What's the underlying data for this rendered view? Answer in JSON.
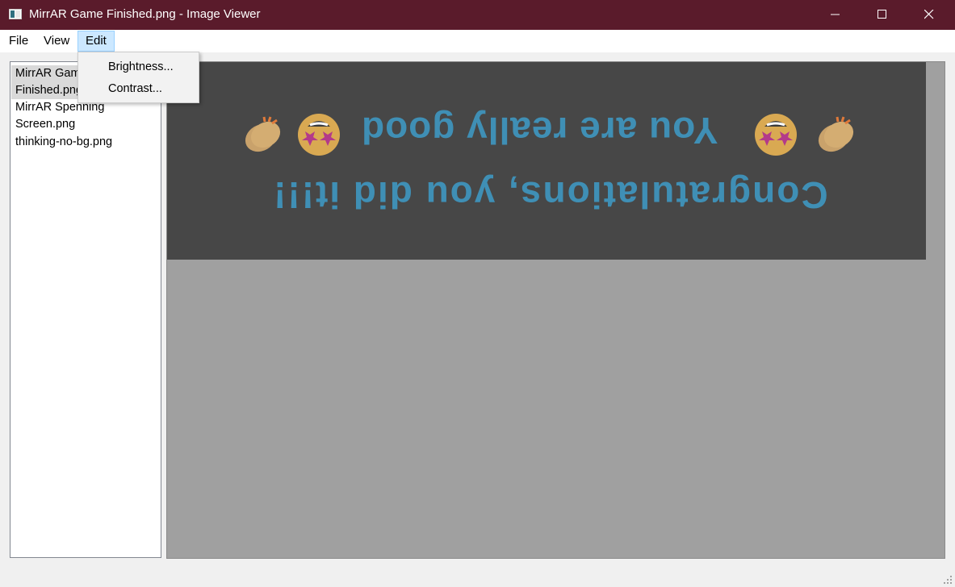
{
  "window": {
    "title": "MirrAR Game Finished.png - Image Viewer",
    "titlebar_color": "#5a1b2b",
    "buttons": [
      "minimize-icon",
      "maximize-icon",
      "close-icon"
    ]
  },
  "menu": {
    "items": [
      {
        "label": "File"
      },
      {
        "label": "View"
      },
      {
        "label": "Edit",
        "active": true
      }
    ],
    "edit_dropdown": [
      {
        "label": "Brightness..."
      },
      {
        "label": "Contrast..."
      }
    ]
  },
  "files": {
    "items": [
      {
        "label_line1": "MirrAR Gam",
        "label_line2": "Finished.png",
        "selected": true
      },
      {
        "label_line1": "MirrAR Spenning",
        "label_line2": "Screen.png",
        "selected": false
      },
      {
        "label_line1": "thinking-no-bg.png",
        "selected": false
      }
    ]
  },
  "image": {
    "background_color": "#474747",
    "text_color": "#3f8fb5",
    "line1": "You are really good",
    "line2": "Congratulations, you did it!!!",
    "orientation": "upside-down",
    "emojis": [
      "clapping-hands-emoji",
      "star-struck-emoji",
      "star-struck-emoji",
      "clapping-hands-emoji"
    ]
  },
  "viewer": {
    "background_color": "#a0a0a0"
  }
}
